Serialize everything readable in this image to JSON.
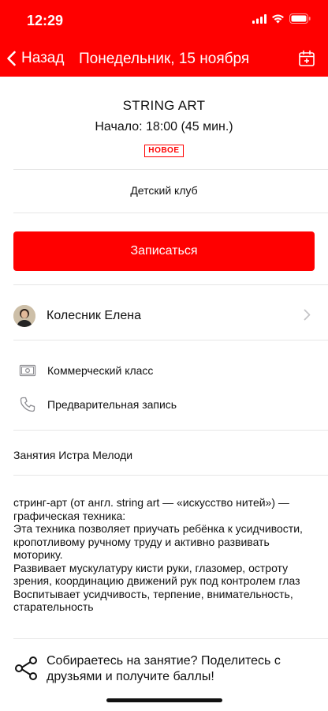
{
  "status_bar": {
    "time": "12:29"
  },
  "nav": {
    "back_label": "Назад",
    "title": "Понедельник, 15 ноября"
  },
  "event": {
    "title": "STRING ART",
    "start": "Начало: 18:00 (45 мин.)",
    "badge": "НОВОЕ",
    "club": "Детский клуб"
  },
  "signup_button": "Записаться",
  "trainer": {
    "name": "Колесник Елена"
  },
  "info": [
    {
      "icon": "banknote-icon",
      "label": "Коммерческий класс"
    },
    {
      "icon": "phone-icon",
      "label": "Предварительная запись"
    }
  ],
  "organization": "Занятия Истра Мелоди",
  "description": [
    "стринг-арт (от англ. string art — «искусство нитей») — графическая техника:",
    "Эта техника позволяет приучать ребёнка к усидчивости, кропотливому ручному труду и активно развивать моторику.",
    "Развивает мускулатуру кисти руки, глазомер, остроту зрения, координацию движений рук под контролем глаз",
    "Воспитывает усидчивость, терпение, внимательность, старательность"
  ],
  "share": {
    "text": "Собираетесь на занятие? Поделитесь с друзьями и получите баллы!"
  },
  "colors": {
    "accent": "#ff0000",
    "divider": "#e6e6e6",
    "text": "#111111",
    "icon_gray": "#8e8e93"
  }
}
